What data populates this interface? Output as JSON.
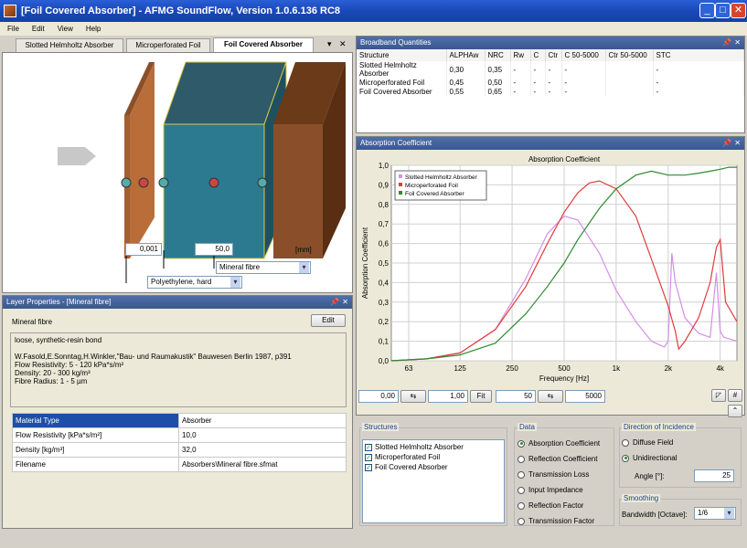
{
  "app": {
    "title": "[Foil Covered Absorber] - AFMG SoundFlow, Version 1.0.6.136 RC8"
  },
  "menu": [
    "File",
    "Edit",
    "View",
    "Help"
  ],
  "tabs": {
    "items": [
      "Slotted Helmholtz Absorber",
      "Microperforated Foil",
      "Foil Covered Absorber"
    ],
    "active": 2,
    "dropdown_glyph": "▾",
    "close_glyph": "✕"
  },
  "model": {
    "thickness_1": "0,001",
    "thickness_2": "50,0",
    "unit": "[mm]",
    "material_1": "Mineral fibre",
    "material_2": "Polyethylene, hard"
  },
  "layer_panel": {
    "title": "Layer Properties - [Mineral fibre]",
    "name": "Mineral fibre",
    "edit_label": "Edit",
    "description": [
      "loose, synthetic-resin bond",
      "",
      "W.Fasold,E.Sonntag,H.Winkler,\"Bau- und Raumakustik\" Bauwesen Berlin 1987, p391",
      "Flow Resistivity: 5 - 120 kPa*s/m²",
      "Density: 20 - 300 kg/m³",
      "Fibre Radius: 1 - 5 µm"
    ],
    "properties": [
      [
        "Material Type",
        "Absorber"
      ],
      [
        "Flow Resistivity [kPa*s/m²]",
        "10,0"
      ],
      [
        "Density [kg/m³]",
        "32,0"
      ],
      [
        "Filename",
        "Absorbers\\Mineral fibre.sfmat"
      ]
    ]
  },
  "broadband": {
    "title": "Broadband Quantities",
    "columns": [
      "Structure",
      "ALPHAw",
      "NRC",
      "Rw",
      "C",
      "Ctr",
      "C 50-5000",
      "Ctr 50-5000",
      "STC"
    ],
    "rows": [
      [
        "Slotted Helmholtz Absorber",
        "0,30",
        "0,35",
        "-",
        "-",
        "-",
        "-",
        "",
        "-"
      ],
      [
        "Microperforated Foil",
        "0,45",
        "0,50",
        "-",
        "-",
        "-",
        "-",
        "",
        "-"
      ],
      [
        "Foil Covered Absorber",
        "0,55",
        "0,65",
        "-",
        "-",
        "-",
        "-",
        "",
        "-"
      ]
    ]
  },
  "absorption_panel": {
    "title": "Absorption Coefficient"
  },
  "chart_data": {
    "type": "line",
    "title": "Absorption Coefficient",
    "xlabel": "Frequency [Hz]",
    "ylabel": "Absorption Coefficient",
    "xscale": "log",
    "xlim": [
      50,
      5000
    ],
    "ylim": [
      0,
      1
    ],
    "xticks": [
      63,
      125,
      250,
      500,
      1000,
      2000,
      4000
    ],
    "xtick_labels": [
      "63",
      "125",
      "250",
      "500",
      "1k",
      "2k",
      "4k"
    ],
    "yticks": [
      0,
      0.1,
      0.2,
      0.3,
      0.4,
      0.5,
      0.6,
      0.7,
      0.8,
      0.9,
      1.0
    ],
    "ytick_labels": [
      "0,0",
      "0,1",
      "0,2",
      "0,3",
      "0,4",
      "0,5",
      "0,6",
      "0,7",
      "0,8",
      "0,9",
      "1,0"
    ],
    "legend": "top-left",
    "grid": true,
    "series": [
      {
        "name": "Slotted Helmholtz Absorber",
        "color": "#d58ee8",
        "x": [
          50,
          80,
          125,
          200,
          300,
          400,
          500,
          600,
          800,
          1000,
          1300,
          1600,
          1900,
          2000,
          2100,
          2200,
          2500,
          3000,
          3500,
          3800,
          4000,
          4200,
          5000
        ],
        "y": [
          0.0,
          0.01,
          0.04,
          0.16,
          0.42,
          0.65,
          0.74,
          0.72,
          0.55,
          0.36,
          0.2,
          0.1,
          0.07,
          0.1,
          0.55,
          0.4,
          0.22,
          0.14,
          0.12,
          0.45,
          0.15,
          0.12,
          0.1
        ]
      },
      {
        "name": "Microperforated Foil",
        "color": "#e03c3c",
        "x": [
          50,
          80,
          125,
          200,
          300,
          400,
          500,
          600,
          700,
          800,
          1000,
          1300,
          1600,
          2000,
          2200,
          2300,
          2500,
          3000,
          3500,
          3800,
          4000,
          4300,
          5000
        ],
        "y": [
          0.0,
          0.01,
          0.04,
          0.16,
          0.38,
          0.6,
          0.76,
          0.86,
          0.91,
          0.92,
          0.88,
          0.74,
          0.52,
          0.28,
          0.15,
          0.06,
          0.1,
          0.22,
          0.4,
          0.58,
          0.62,
          0.3,
          0.2
        ]
      },
      {
        "name": "Foil Covered Absorber",
        "color": "#2f8a2f",
        "x": [
          50,
          80,
          125,
          200,
          300,
          400,
          500,
          600,
          800,
          1000,
          1300,
          1600,
          2000,
          2500,
          3000,
          3500,
          4000,
          4500,
          5000
        ],
        "y": [
          0.0,
          0.01,
          0.03,
          0.09,
          0.24,
          0.38,
          0.5,
          0.62,
          0.78,
          0.88,
          0.95,
          0.97,
          0.95,
          0.95,
          0.96,
          0.97,
          0.98,
          0.99,
          0.99
        ]
      }
    ]
  },
  "range": {
    "y_min": "0,00",
    "y_max": "1,00",
    "fit_label": "Fit",
    "f_min": "50",
    "f_max": "5000"
  },
  "structures": {
    "title": "Structures",
    "items": [
      "Slotted Helmholtz Absorber",
      "Microperforated Foil",
      "Foil Covered Absorber"
    ]
  },
  "data_group": {
    "title": "Data",
    "options": [
      "Absorption Coefficient",
      "Reflection Coefficient",
      "Transmission Loss",
      "Input Impedance",
      "Reflection Factor",
      "Transmission Factor"
    ],
    "selected": 0
  },
  "incidence": {
    "title": "Direction of Incidence",
    "options": [
      "Diffuse Field",
      "Unidirectional"
    ],
    "selected": 1,
    "angle_label": "Angle [°]:",
    "angle": "25"
  },
  "smoothing": {
    "title": "Smoothing",
    "label": "Bandwidth [Octave]:",
    "value": "1/6"
  }
}
